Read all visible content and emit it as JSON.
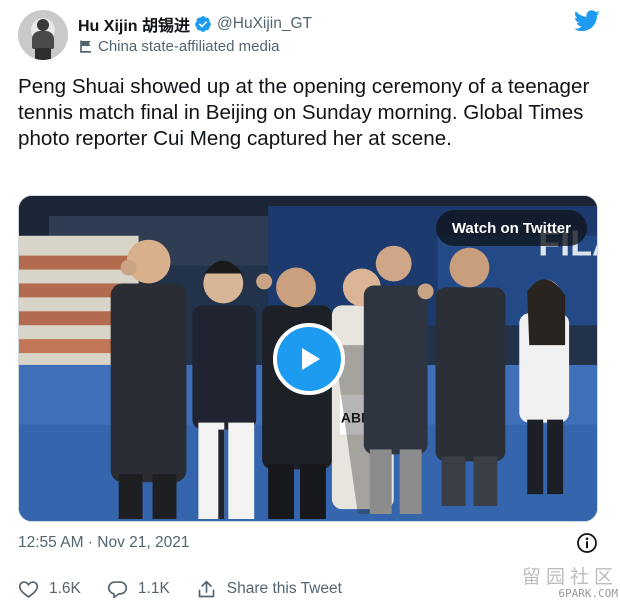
{
  "author": {
    "display_name": "Hu Xijin 胡锡进",
    "handle": "@HuXijin_GT",
    "affiliation_label": "China state-affiliated media"
  },
  "tweet": {
    "text": "Peng Shuai showed up at the opening ceremony of a teenager tennis match final in Beijing on Sunday morning. Global Times photo reporter Cui Meng captured her at scene.",
    "timestamp": "12:55 AM · Nov 21, 2021"
  },
  "media": {
    "watch_label": "Watch on Twitter",
    "play_icon": "play-icon",
    "court_sign_text": "FILA",
    "jersey_text": "ABIELI"
  },
  "actions": {
    "likes": "1.6K",
    "replies": "1.1K",
    "share_label": "Share this Tweet"
  },
  "watermark": {
    "chars": "留园社区",
    "site": "6PARK.COM"
  },
  "colors": {
    "accent": "#1d9bf0",
    "secondary_text": "#536471",
    "primary_text": "#0f1419"
  }
}
